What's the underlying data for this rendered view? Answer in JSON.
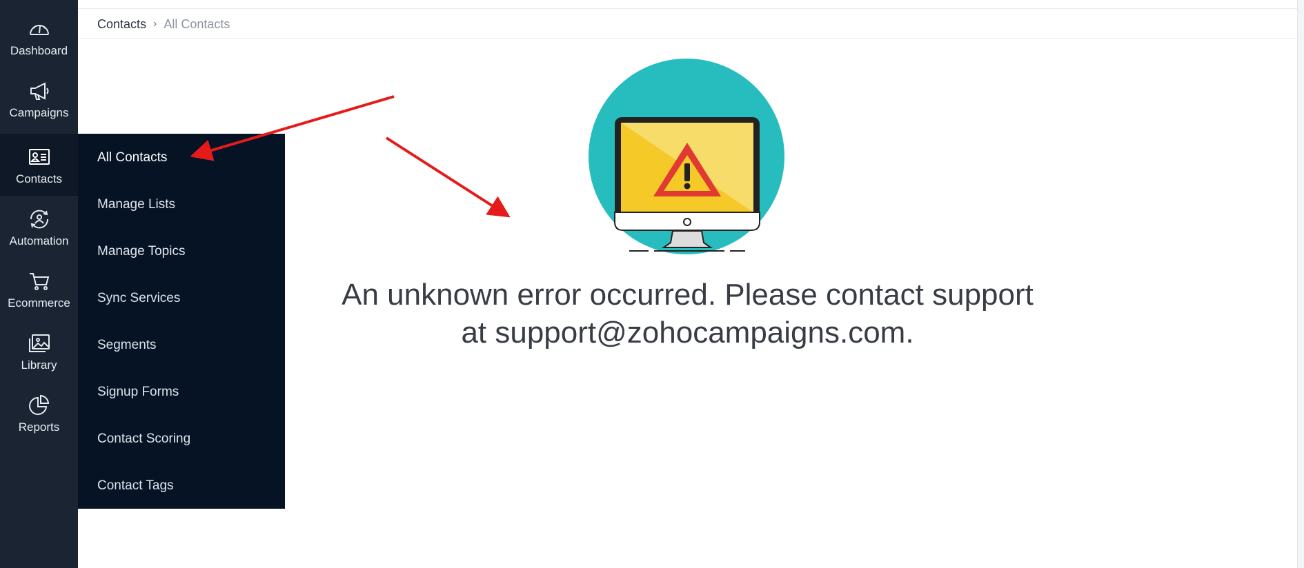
{
  "sidebar": {
    "items": [
      {
        "label": "Dashboard",
        "icon": "dashboard-gauge-icon"
      },
      {
        "label": "Campaigns",
        "icon": "megaphone-icon"
      },
      {
        "label": "Contacts",
        "icon": "contact-card-icon",
        "active": true
      },
      {
        "label": "Automation",
        "icon": "automation-icon"
      },
      {
        "label": "Ecommerce",
        "icon": "shopping-cart-icon"
      },
      {
        "label": "Library",
        "icon": "image-library-icon"
      },
      {
        "label": "Reports",
        "icon": "pie-chart-icon"
      }
    ]
  },
  "submenu": {
    "items": [
      {
        "label": "All Contacts",
        "active": true
      },
      {
        "label": "Manage Lists"
      },
      {
        "label": "Manage Topics"
      },
      {
        "label": "Sync Services"
      },
      {
        "label": "Segments"
      },
      {
        "label": "Signup Forms"
      },
      {
        "label": "Contact Scoring"
      },
      {
        "label": "Contact Tags"
      }
    ]
  },
  "breadcrumb": {
    "root": "Contacts",
    "separator": "›",
    "current": "All Contacts"
  },
  "error": {
    "line1": "An unknown error occurred. Please contact support",
    "line2": "at support@zohocampaigns.com.",
    "icon": "warning-monitor-icon"
  },
  "colors": {
    "sidebar_bg": "#1a2433",
    "submenu_bg": "#051325",
    "illustration_circle": "#27bdbe",
    "warning_yellow": "#f5c928",
    "warning_red": "#e03a32",
    "annotation_arrow": "#e51b1b"
  }
}
